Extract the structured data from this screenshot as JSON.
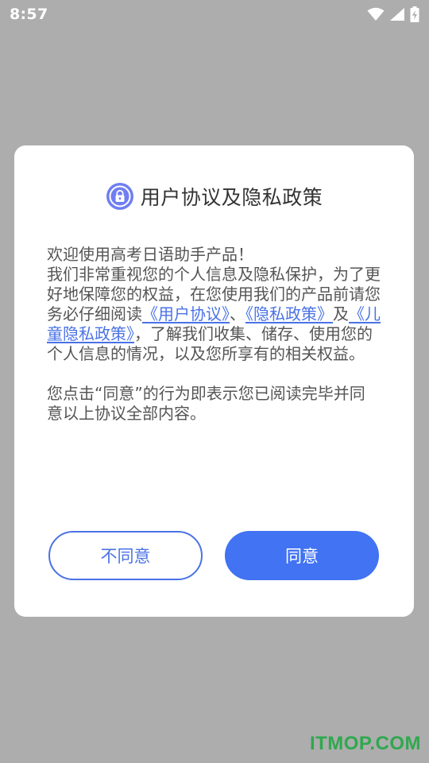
{
  "status_bar": {
    "time": "8:57",
    "icons": [
      "wifi-icon",
      "cellular-signal-icon",
      "battery-charging-icon"
    ]
  },
  "dialog": {
    "icon": "lock-icon",
    "title": "用户协议及隐私政策",
    "paragraph1": {
      "line1": "欢迎使用高考日语助手产品！",
      "intro": "我们非常重视您的个人信息及隐私保护，为了更好地保障您的权益，在您使用我们的产品前请您务必仔细阅读",
      "link_user_agreement": "《用户协议》",
      "sep1": "、",
      "link_privacy_policy": "《隐私政策》",
      "sep2": "及",
      "link_children_privacy": "《儿童隐私政策》",
      "outro": "，了解我们收集、储存、使用您的个人信息的情况，以及您所享有的相关权益。"
    },
    "paragraph2": "您点击“同意”的行为即表示您已阅读完毕并同意以上协议全部内容。",
    "buttons": {
      "disagree": "不同意",
      "agree": "同意"
    }
  },
  "colors": {
    "accent": "#4173f2",
    "link": "#4a72e6",
    "overlay": "#adadad"
  },
  "watermark": "ITMOP.COM"
}
